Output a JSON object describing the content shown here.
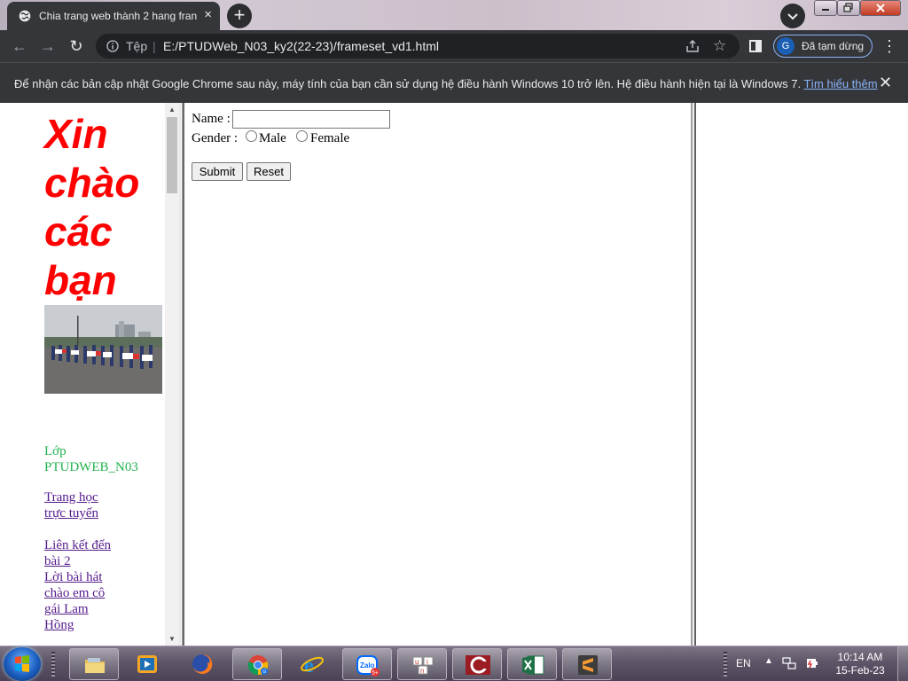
{
  "tab": {
    "title": "Chia trang web thành 2 hang fran",
    "close": "×"
  },
  "toolbar": {
    "new_tab": "+",
    "back": "←",
    "forward": "→",
    "reload": "↻",
    "security_label": "Tệp",
    "separator": "|",
    "url": "E:/PTUDWeb_N03_ky2(22-23)/frameset_vd1.html",
    "star": "☆",
    "profile_initial": "G",
    "profile_label": "Đã tạm dừng",
    "menu": "⋮"
  },
  "infobar": {
    "message": "Để nhận các bản cập nhật Google Chrome sau này, máy tính của bạn cần sử dụng hệ điều hành Windows 10 trở lên. Hệ điều hành hiện tại là Windows 7.",
    "link": "Tìm hiểu thêm",
    "close": "✕"
  },
  "left_frame": {
    "heading_lines": [
      "Xin",
      "chào",
      "các",
      "bạn"
    ],
    "class_label_lines": [
      "Lớp",
      "PTUDWEB_N03"
    ],
    "link_online_lines": [
      "Trang học",
      "trực tuyến"
    ],
    "link_lesson2_lines": [
      "Liên kết đến",
      "bài 2"
    ],
    "link_song_lines": [
      "Lời bài hát",
      "chào em cô",
      "gái Lam",
      "Hồng"
    ]
  },
  "form": {
    "name_label": "Name :",
    "name_value": "",
    "gender_label": "Gender :",
    "male_label": "Male",
    "female_label": "Female",
    "submit_label": "Submit",
    "reset_label": "Reset"
  },
  "taskbar": {
    "language": "EN",
    "time": "10:14 AM",
    "date": "15-Feb-23"
  },
  "icons": {
    "tab_favicon": "globe-icon",
    "back": "arrow-left-icon",
    "forward": "arrow-right-icon",
    "reload": "reload-icon",
    "info": "info-icon",
    "share": "share-icon",
    "star": "star-icon",
    "side_panel": "side-panel-icon",
    "menu": "three-dots-icon",
    "start": "windows-start-icon",
    "explorer": "folder-icon",
    "media": "media-player-icon",
    "firefox": "firefox-icon",
    "chrome": "chrome-icon",
    "ie": "internet-explorer-icon",
    "zalo": "zalo-icon",
    "unikey": "unikey-icon",
    "media_app": "red-app-icon",
    "excel": "excel-icon",
    "sublime": "sublime-text-icon"
  },
  "colors": {
    "heading": "#ff0000",
    "class_label": "#22b14c",
    "visited_link": "#551a8b",
    "chrome_dark": "#35363a",
    "info_link": "#8ab4f8"
  }
}
